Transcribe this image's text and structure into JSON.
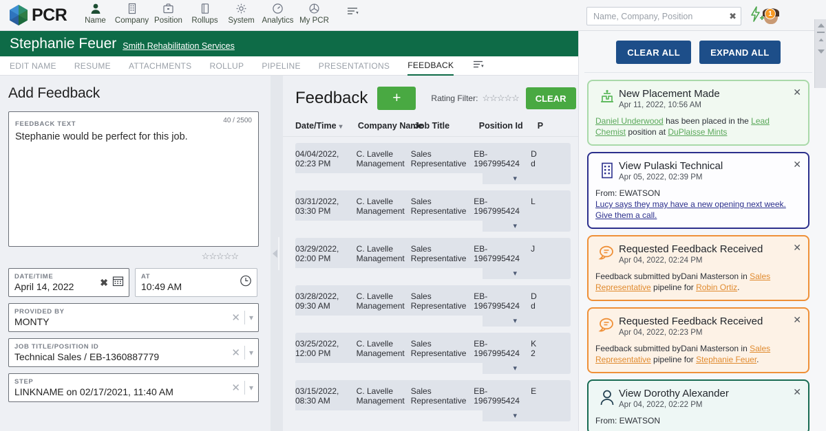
{
  "topbar": {
    "logo_text": "PCR",
    "nav": [
      {
        "label": "Name",
        "icon": "person-icon"
      },
      {
        "label": "Company",
        "icon": "building-icon"
      },
      {
        "label": "Position",
        "icon": "briefcase-icon"
      },
      {
        "label": "Rollups",
        "icon": "book-icon"
      },
      {
        "label": "System",
        "icon": "gear-icon"
      },
      {
        "label": "Analytics",
        "icon": "gauge-icon"
      },
      {
        "label": "My PCR",
        "icon": "globe-icon"
      }
    ],
    "menu_icon": "list-settings-icon",
    "search": {
      "placeholder": "Name, Company, Position",
      "value": "",
      "clear_icon": "close-icon"
    },
    "quick_add_icon": "lightning-plus-icon",
    "avatar_icon": "avatar",
    "avatar_badge": "1"
  },
  "record": {
    "name": "Stephanie Feuer",
    "company": "Smith Rehabilitation Services",
    "tabs": [
      {
        "label": "EDIT NAME",
        "active": false
      },
      {
        "label": "RESUME",
        "active": false
      },
      {
        "label": "ATTACHMENTS",
        "active": false
      },
      {
        "label": "ROLLUP",
        "active": false
      },
      {
        "label": "PIPELINE",
        "active": false
      },
      {
        "label": "PRESENTATIONS",
        "active": false
      },
      {
        "label": "FEEDBACK",
        "active": true
      }
    ],
    "tab_menu_icon": "list-settings-icon"
  },
  "add_feedback": {
    "title": "Add Feedback",
    "feedback_text": {
      "label": "FEEDBACK TEXT",
      "value": "Stephanie would be perfect for this job.",
      "counter": "40 / 2500"
    },
    "rating_stars": 5,
    "rating_filled": 0,
    "date_time": {
      "label": "DATE/TIME",
      "value": "April 14, 2022",
      "icon": "calendar-icon"
    },
    "at": {
      "label": "AT",
      "value": "10:49 AM",
      "icon": "clock-icon"
    },
    "provided_by": {
      "label": "PROVIDED BY",
      "value": "MONTY"
    },
    "job_title": {
      "label": "JOB TITLE/POSITION ID",
      "value": "Technical Sales / EB-1360887779"
    },
    "step": {
      "label": "STEP",
      "value": "LINKNAME on 02/17/2021, 11:40 AM"
    }
  },
  "feedback_list": {
    "title": "Feedback",
    "add_label": "+",
    "rating_filter_label": "Rating Filter:",
    "rating_filter_stars": 5,
    "clear_label": "CLEAR",
    "columns": [
      "Date/Time",
      "Company Name",
      "Job Title",
      "Position Id",
      "P"
    ],
    "rows": [
      {
        "date": "04/04/2022,",
        "time": "02:23 PM",
        "company": "C. Lavelle",
        "company2": "Management",
        "job": "Sales",
        "job2": "Representative",
        "position_a": "EB-",
        "position_b": "1967995424",
        "p1": "D",
        "p2": "d"
      },
      {
        "date": "03/31/2022,",
        "time": "03:30 PM",
        "company": "C. Lavelle",
        "company2": "Management",
        "job": "Sales",
        "job2": "Representative",
        "position_a": "EB-",
        "position_b": "1967995424",
        "p1": "L",
        "p2": ""
      },
      {
        "date": "03/29/2022,",
        "time": "02:00 PM",
        "company": "C. Lavelle",
        "company2": "Management",
        "job": "Sales",
        "job2": "Representative",
        "position_a": "EB-",
        "position_b": "1967995424",
        "p1": "J",
        "p2": ""
      },
      {
        "date": "03/28/2022,",
        "time": "09:30 AM",
        "company": "C. Lavelle",
        "company2": "Management",
        "job": "Sales",
        "job2": "Representative",
        "position_a": "EB-",
        "position_b": "1967995424",
        "p1": "D",
        "p2": "d"
      },
      {
        "date": "03/25/2022,",
        "time": "12:00 PM",
        "company": "C. Lavelle",
        "company2": "Management",
        "job": "Sales",
        "job2": "Representative",
        "position_a": "EB-",
        "position_b": "1967995424",
        "p1": "K",
        "p2": "2"
      },
      {
        "date": "03/15/2022,",
        "time": "08:30 AM",
        "company": "C. Lavelle",
        "company2": "Management",
        "job": "Sales",
        "job2": "Representative",
        "position_a": "EB-",
        "position_b": "1967995424",
        "p1": "E",
        "p2": ""
      }
    ]
  },
  "notifications": {
    "clear_all": "CLEAR ALL",
    "expand_all": "EXPAND ALL",
    "cards": [
      {
        "type": "green",
        "icon": "placement-icon",
        "title": "New Placement Made",
        "date": "Apr 11, 2022, 10:56 AM",
        "body_parts": [
          {
            "t": "Daniel Underwood",
            "link": true
          },
          {
            "t": " has been placed in the ",
            "link": false
          },
          {
            "t": "Lead Chemist",
            "link": true
          },
          {
            "t": " position at ",
            "link": false
          },
          {
            "t": "DuPlaisse Mints",
            "link": true
          }
        ]
      },
      {
        "type": "blue",
        "icon": "building-icon",
        "title": "View Pulaski Technical",
        "date": "Apr 05, 2022, 02:39 PM",
        "body_parts": [
          {
            "t": "From: EWATSON",
            "link": false,
            "br": true
          },
          {
            "t": "Lucy says they may have a new opening next week. Give them a call.",
            "link": true
          }
        ]
      },
      {
        "type": "orange",
        "icon": "chat-icon",
        "title": "Requested Feedback Received",
        "date": "Apr 04, 2022, 02:24 PM",
        "body_parts": [
          {
            "t": "Feedback submitted byDani Masterson in ",
            "link": false
          },
          {
            "t": "Sales Representative",
            "link": true
          },
          {
            "t": " pipeline for ",
            "link": false
          },
          {
            "t": "Robin Ortiz",
            "link": true
          },
          {
            "t": ".",
            "link": false
          }
        ]
      },
      {
        "type": "orange",
        "icon": "chat-icon",
        "title": "Requested Feedback Received",
        "date": "Apr 04, 2022, 02:23 PM",
        "body_parts": [
          {
            "t": "Feedback submitted byDani Masterson in ",
            "link": false
          },
          {
            "t": "Sales Representative",
            "link": true
          },
          {
            "t": " pipeline for ",
            "link": false
          },
          {
            "t": "Stephanie Feuer",
            "link": true
          },
          {
            "t": ".",
            "link": false
          }
        ]
      },
      {
        "type": "teal",
        "icon": "person-icon",
        "title": "View Dorothy Alexander",
        "date": "Apr 04, 2022, 02:22 PM",
        "body_parts": [
          {
            "t": "From: EWATSON",
            "link": false
          }
        ]
      }
    ],
    "close_icon": "close-icon"
  },
  "colors": {
    "brand_green": "#0e6b47",
    "action_green": "#49a942",
    "nav_blue": "#1d4e89",
    "badge_orange": "#f79824"
  }
}
